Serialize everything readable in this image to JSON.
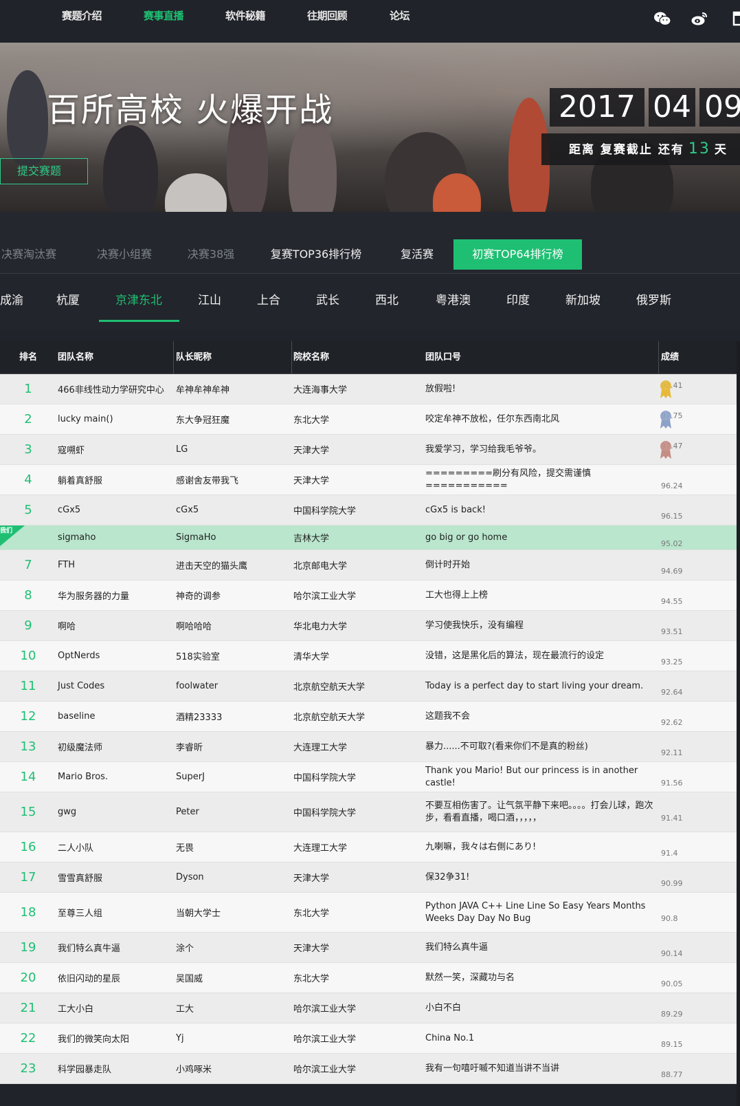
{
  "nav": {
    "items": [
      "赛题介绍",
      "赛事直播",
      "软件秘籍",
      "往期回顾",
      "论坛"
    ],
    "active_index": 1,
    "icons": [
      "wechat-icon",
      "weibo-icon",
      "calendar-icon"
    ]
  },
  "banner": {
    "title": "百所高校 火爆开战",
    "submit_label": "提交赛题",
    "date_year": "2017",
    "date_month": "04",
    "date_day": "09",
    "countdown_prefix": "距离 复赛截止 还有",
    "countdown_days": "13",
    "countdown_suffix": "天"
  },
  "tabs": {
    "items": [
      "决赛淘汰赛",
      "决赛小组赛",
      "决赛38强",
      "复赛TOP36排行榜",
      "复活赛",
      "初赛TOP64排行榜"
    ],
    "active_index": 5
  },
  "regions": {
    "items": [
      "成渝",
      "杭厦",
      "京津东北",
      "江山",
      "上合",
      "武长",
      "西北",
      "粤港澳",
      "印度",
      "新加坡",
      "俄罗斯"
    ],
    "active_index": 2
  },
  "table": {
    "headers": [
      "排名",
      "团队名称",
      "队长昵称",
      "院校名称",
      "团队口号",
      "成绩"
    ],
    "highlight_tag": "我们",
    "rows": [
      {
        "rank": "1",
        "team": "466非线性动力学研究中心",
        "captain": "牟神牟神牟神",
        "school": "大连海事大学",
        "slogan": "放假啦!",
        "score": "98.41",
        "medal": "gold"
      },
      {
        "rank": "2",
        "team": "lucky main()",
        "captain": "东大争冠狂魔",
        "school": "东北大学",
        "slogan": "咬定牟神不放松，任尔东西南北风",
        "score": "97.75",
        "medal": "silver"
      },
      {
        "rank": "3",
        "team": "寇嗍虾",
        "captain": "LG",
        "school": "天津大学",
        "slogan": "我爱学习，学习给我毛爷爷。",
        "score": "97.47",
        "medal": "bronze"
      },
      {
        "rank": "4",
        "team": "躺着真舒服",
        "captain": "感谢舍友带我飞",
        "school": "天津大学",
        "slogan": "=========刷分有风险，提交需谨慎===========",
        "score": "96.24"
      },
      {
        "rank": "5",
        "team": "cGx5",
        "captain": "cGx5",
        "school": "中国科学院大学",
        "slogan": "cGx5 is back!",
        "score": "96.15"
      },
      {
        "rank": "",
        "team": "sigmaho",
        "captain": "SigmaHo",
        "school": "吉林大学",
        "slogan": "go big or go home",
        "score": "95.02",
        "highlight": true
      },
      {
        "rank": "7",
        "team": "FTH",
        "captain": "进击天空的猫头鹰",
        "school": "北京邮电大学",
        "slogan": "倒计时开始",
        "score": "94.69"
      },
      {
        "rank": "8",
        "team": "华为服务器的力量",
        "captain": "神奇的调参",
        "school": "哈尔滨工业大学",
        "slogan": "工大也得上上榜",
        "score": "94.55"
      },
      {
        "rank": "9",
        "team": "啊哈",
        "captain": "啊哈哈哈",
        "school": "华北电力大学",
        "slogan": "学习使我快乐，没有编程",
        "score": "93.51"
      },
      {
        "rank": "10",
        "team": "OptNerds",
        "captain": "518实验室",
        "school": "清华大学",
        "slogan": "没错，这是黑化后的算法，现在最流行的设定",
        "score": "93.25"
      },
      {
        "rank": "11",
        "team": "Just Codes",
        "captain": "foolwater",
        "school": "北京航空航天大学",
        "slogan": "Today is a perfect day to start living your dream.",
        "score": "92.64"
      },
      {
        "rank": "12",
        "team": "baseline",
        "captain": "酒精23333",
        "school": "北京航空航天大学",
        "slogan": "这题我不会",
        "score": "92.62"
      },
      {
        "rank": "13",
        "team": "初级魔法师",
        "captain": "李睿昕",
        "school": "大连理工大学",
        "slogan": "暴力......不可取?(看来你们不是真的粉丝)",
        "score": "92.11"
      },
      {
        "rank": "14",
        "team": "Mario Bros.",
        "captain": "SuperJ",
        "school": "中国科学院大学",
        "slogan": "Thank you Mario! But our princess is in another castle!",
        "score": "91.56"
      },
      {
        "rank": "15",
        "team": "gwg",
        "captain": "Peter",
        "school": "中国科学院大学",
        "slogan": "不要互相伤害了。让气氛平静下来吧。。。。打会儿球，跑次步，看看直播，喝口酒，，，，，",
        "score": "91.41",
        "tall": true
      },
      {
        "rank": "16",
        "team": "二人小队",
        "captain": "无畏",
        "school": "大连理工大学",
        "slogan": "九喇嘛，我々は右側にあり!",
        "score": "91.4"
      },
      {
        "rank": "17",
        "team": "雪雪真舒服",
        "captain": "Dyson",
        "school": "天津大学",
        "slogan": "保32争31!",
        "score": "90.99"
      },
      {
        "rank": "18",
        "team": "至尊三人组",
        "captain": "当朝大学士",
        "school": "东北大学",
        "slogan": "Python JAVA C++ Line Line So Easy Years Months Weeks Day Day No Bug",
        "score": "90.8",
        "tall": true
      },
      {
        "rank": "19",
        "team": "我们特么真牛逼",
        "captain": "涂个",
        "school": "天津大学",
        "slogan": "我们特么真牛逼",
        "score": "90.14"
      },
      {
        "rank": "20",
        "team": "依旧闪动的星辰",
        "captain": "吴国威",
        "school": "东北大学",
        "slogan": "默然一笑，深藏功与名",
        "score": "90.05"
      },
      {
        "rank": "21",
        "team": "工大小白",
        "captain": "工大",
        "school": "哈尔滨工业大学",
        "slogan": "小白不白",
        "score": "89.29"
      },
      {
        "rank": "22",
        "team": "我们的微笑向太阳",
        "captain": "Yj",
        "school": "哈尔滨工业大学",
        "slogan": "China No.1",
        "score": "89.15"
      },
      {
        "rank": "23",
        "team": "科学园暴走队",
        "captain": "小鸡啄米",
        "school": "哈尔滨工业大学",
        "slogan": "我有一句嘻吁嘁不知道当讲不当讲",
        "score": "88.77"
      }
    ]
  },
  "colors": {
    "accent": "#1fbf73",
    "highlight_row": "#b9e6cd",
    "gold": "#e5b93a",
    "silver": "#8da2c8",
    "bronze": "#c48e85"
  }
}
